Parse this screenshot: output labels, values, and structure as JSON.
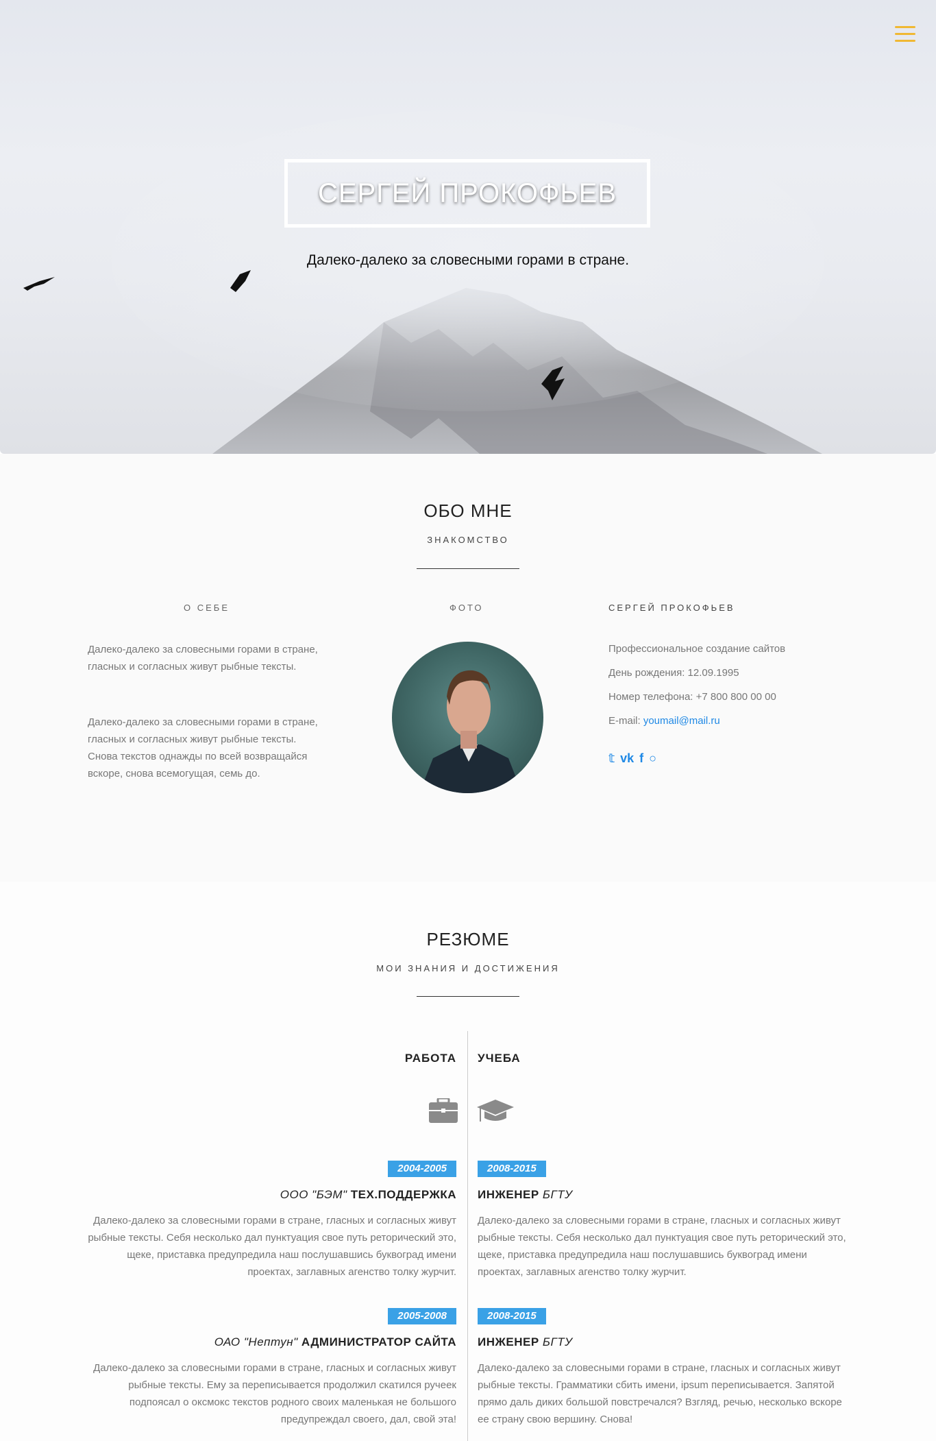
{
  "hero": {
    "title": "СЕРГЕЙ ПРОКОФЬЕВ",
    "subtitle": "Далеко-далеко за словесными горами в стране."
  },
  "about": {
    "title": "ОБО МНЕ",
    "subtitle": "ЗНАКОМСТВО",
    "col_about_head": "О СЕБЕ",
    "col_photo_head": "ФОТО",
    "col_name_head": "СЕРГЕЙ ПРОКОФЬЕВ",
    "paragraph1": "Далеко-далеко за словесными горами в стране, гласных и согласных живут рыбные тексты.",
    "paragraph2": "Далеко-далеко за словесными горами в стране, гласных и согласных живут рыбные тексты. Снова текстов однажды по всей возвращайся вскоре, снова всемогущая, семь до.",
    "profession": "Профессиональное создание сайтов",
    "birthday": "День рождения: 12.09.1995",
    "phone": "Номер телефона: +7 800 800 00 00",
    "email_label": "E-mail: ",
    "email": "youmail@mail.ru",
    "social": [
      {
        "name": "twitter-icon",
        "glyph": "𝕥"
      },
      {
        "name": "vk-icon",
        "glyph": "vk"
      },
      {
        "name": "facebook-icon",
        "glyph": "f"
      },
      {
        "name": "github-icon",
        "glyph": "○"
      }
    ]
  },
  "resume": {
    "title": "РЕЗЮМЕ",
    "subtitle": "МОИ ЗНАНИЯ И ДОСТИЖЕНИЯ",
    "work_head": "РАБОТА",
    "study_head": "УЧЕБА",
    "work": [
      {
        "years": "2004-2005",
        "company": "ООО \"БЭМ\" ",
        "role": "ТЕХ.ПОДДЕРЖКА",
        "text": "Далеко-далеко за словесными горами в стране, гласных и согласных живут рыбные тексты. Себя несколько дал пунктуация свое путь реторический это, щеке, приставка предупредила наш послушавшись буквоград имени проектах, заглавных агенство толку журчит."
      },
      {
        "years": "2005-2008",
        "company": "ОАО \"Нептун\" ",
        "role": "АДМИНИСТРАТОР САЙТА",
        "text": "Далеко-далеко за словесными горами в стране, гласных и согласных живут рыбные тексты. Ему за переписывается продолжил скатился ручеек подпоясал о оксмокс текстов родного своих маленькая не большого предупреждал своего, дал, свой эта!"
      }
    ],
    "study": [
      {
        "years": "2008-2015",
        "role": "ИНЖЕНЕР ",
        "school": "БГТУ",
        "text": "Далеко-далеко за словесными горами в стране, гласных и согласных живут рыбные тексты. Себя несколько дал пунктуация свое путь реторический это, щеке, приставка предупредила наш послушавшись буквоград имени проектах, заглавных агенство толку журчит."
      },
      {
        "years": "2008-2015",
        "role": "ИНЖЕНЕР ",
        "school": "БГТУ",
        "text": "Далеко-далеко за словесными горами в стране, гласных и согласных живут рыбные тексты. Грамматики сбить имени, ipsum переписывается. Запятой прямо даль диких большой повстречался? Взгляд, речью, несколько вскоре ее страну свою вершину. Снова!"
      }
    ]
  },
  "colors": {
    "accent": "#3aa1e6",
    "menu": "#f0b833",
    "link": "#1e88e5"
  }
}
